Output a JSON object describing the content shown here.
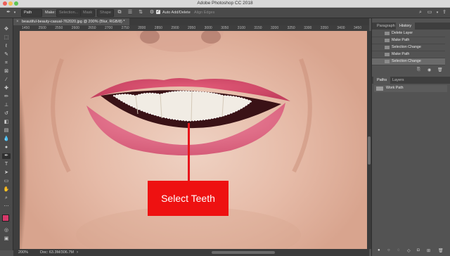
{
  "window": {
    "title": "Adobe Photoshop CC 2018",
    "traffic_light_colors": [
      "#ec5f59",
      "#f5bf4f",
      "#5fc453"
    ]
  },
  "options_bar": {
    "tool_icon": "pen-icon",
    "mode_value": "Path",
    "make_label": "Make:",
    "selection_label": "Selection...",
    "mask_label": "Mask",
    "shape_label": "Shape",
    "auto_add_delete_label": "Auto Add/Delete",
    "auto_add_delete_checked": true,
    "align_edges_label": "Align Edges"
  },
  "document": {
    "tab_title": "beautiful-beauty-casual-762020.jpg @ 200% (Blur, RGB/8) *",
    "ruler_ticks": [
      "1450",
      "2500",
      "2550",
      "2600",
      "2650",
      "2700",
      "2750",
      "2800",
      "2850",
      "2900",
      "2950",
      "3000",
      "3050",
      "3100",
      "3150",
      "3200",
      "3250",
      "3300",
      "3350",
      "3400",
      "3450"
    ]
  },
  "status_bar": {
    "zoom": "200%",
    "doc_info": "Doc: 63.3M/306.7M"
  },
  "history_panel": {
    "tabs": [
      "Paragraph",
      "History"
    ],
    "active_tab": "History",
    "items": [
      "Delete Layer",
      "Make Path",
      "Selection Change",
      "Make Path",
      "Selection Change"
    ],
    "selected_index": 4
  },
  "paths_panel": {
    "tabs": [
      "Paths",
      "Layers"
    ],
    "active_tab": "Paths",
    "items": [
      "Work Path"
    ]
  },
  "annotation": {
    "label": "Select Teeth",
    "color": "#ee1111"
  }
}
